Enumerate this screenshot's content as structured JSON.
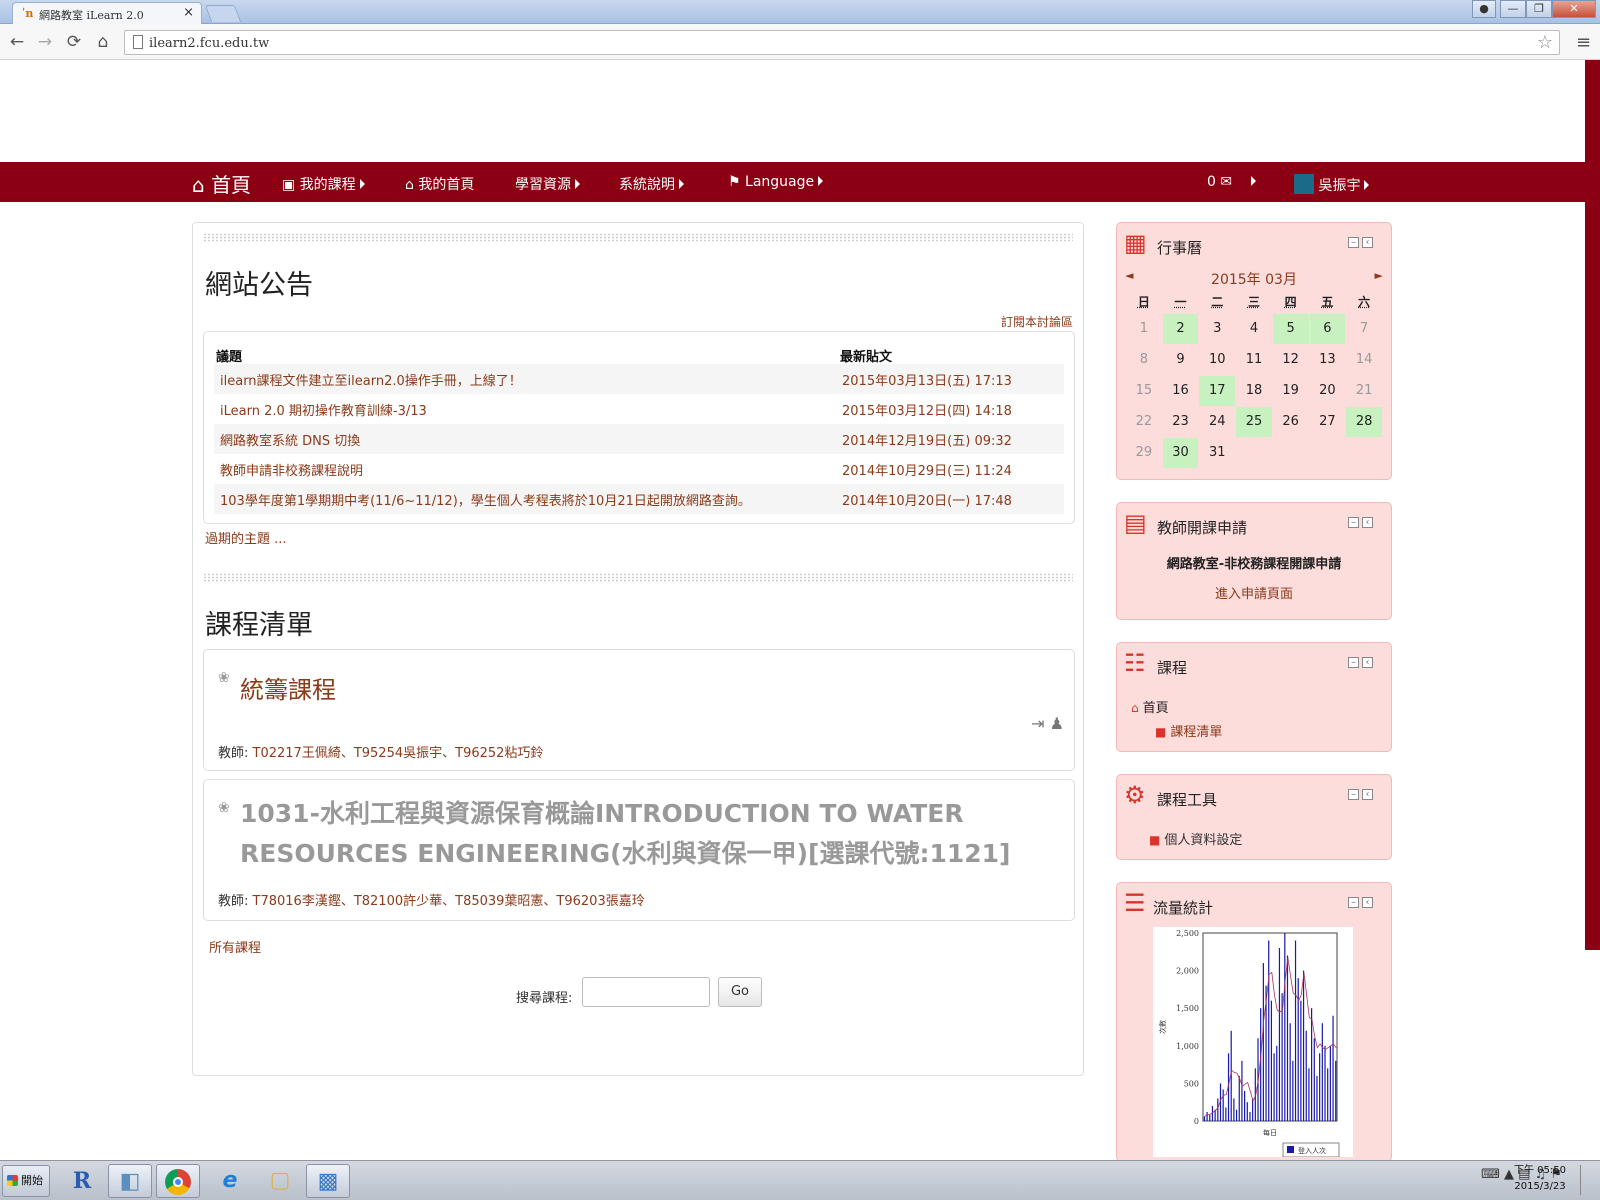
{
  "browser": {
    "tab_title": "網路教室 iLearn 2.0",
    "tab_close": "×",
    "url": "ilearn2.fcu.edu.tw",
    "back_icon": "←",
    "forward_icon": "→",
    "reload_icon": "⟳",
    "home_icon": "⌂",
    "star_icon": "☆",
    "menu_icon": "≡"
  },
  "navbar": {
    "home": "首頁",
    "my_courses": "我的課程",
    "my_home": "我的首頁",
    "resources": "學習資源",
    "system_help": "系統說明",
    "language": "Language",
    "messages": "0",
    "user_name": "吳振宇"
  },
  "announcements": {
    "title": "網站公告",
    "subscribe": "訂閱本討論區",
    "col_topic": "議題",
    "col_latest": "最新貼文",
    "rows": [
      {
        "topic": "ilearn課程文件建立至ilearn2.0操作手冊，上線了！",
        "date": "2015年03月13日(五) 17:13"
      },
      {
        "topic": "iLearn 2.0 期初操作教育訓練-3/13",
        "date": "2015年03月12日(四) 14:18"
      },
      {
        "topic": "網路教室系統 DNS 切換",
        "date": "2014年12月19日(五) 09:32"
      },
      {
        "topic": "教師申請非校務課程說明",
        "date": "2014年10月29日(三) 11:24"
      },
      {
        "topic": "103學年度第1學期期中考(11/6~11/12)，學生個人考程表將於10月21日起開放網路查詢。",
        "date": "2014年10月20日(一) 17:48"
      }
    ],
    "older": "過期的主題 ..."
  },
  "courses": {
    "title": "課程清單",
    "items": [
      {
        "name": "統籌課程",
        "teacher_label": "教師:",
        "teachers": "T02217王佩綺、T95254吳振宇、T96252粘巧鈴"
      },
      {
        "name": "1031-水利工程與資源保育概論INTRODUCTION TO WATER RESOURCES ENGINEERING(水利與資保一甲)[選課代號:1121]",
        "teacher_label": "教師:",
        "teachers": "T78016李漢鏗、T82100許少華、T85039葉昭憲、T96203張嘉玲"
      }
    ],
    "all_courses": "所有課程",
    "search_label": "搜尋課程:",
    "search_value": "",
    "go": "Go"
  },
  "calendar": {
    "title": "行事曆",
    "month": "2015年 03月",
    "prev": "◄",
    "next": "►",
    "weekdays": [
      "日",
      "一",
      "二",
      "三",
      "四",
      "五",
      "六"
    ],
    "weeks": [
      [
        "1",
        "2",
        "3",
        "4",
        "5",
        "6",
        "7"
      ],
      [
        "8",
        "9",
        "10",
        "11",
        "12",
        "13",
        "14"
      ],
      [
        "15",
        "16",
        "17",
        "18",
        "19",
        "20",
        "21"
      ],
      [
        "22",
        "23",
        "24",
        "25",
        "26",
        "27",
        "28"
      ],
      [
        "29",
        "30",
        "31",
        "",
        "",
        "",
        ""
      ]
    ],
    "event_days": [
      "2",
      "5",
      "6",
      "17",
      "25",
      "28",
      "30"
    ]
  },
  "teacher_apply": {
    "title": "教師開課申請",
    "heading": "網路教室-非校務課程開課申請",
    "link": "進入申請頁面"
  },
  "course_nav": {
    "title": "課程",
    "home": "首頁",
    "list": "課程清單"
  },
  "course_tools": {
    "title": "課程工具",
    "profile": "個人資料設定"
  },
  "traffic": {
    "title": "流量統計"
  },
  "chart_data": {
    "type": "bar",
    "ylabel": "次數",
    "xlabel": "每日",
    "yticks": [
      "0",
      "500",
      "1,000",
      "1,500",
      "2,000",
      "2,500"
    ],
    "ylim": [
      0,
      2500
    ],
    "legend": "登入人次",
    "values": [
      60,
      120,
      80,
      200,
      150,
      300,
      500,
      420,
      180,
      900,
      1200,
      300,
      150,
      600,
      800,
      400,
      250,
      120,
      300,
      700,
      1100,
      1500,
      2100,
      1800,
      2400,
      1600,
      900,
      1000,
      2300,
      1700,
      2500,
      2200,
      1300,
      800,
      2400,
      1900,
      1600,
      2000,
      1200,
      700,
      1500,
      1100,
      600,
      900,
      1300,
      1000,
      700,
      1000,
      1400,
      800
    ]
  },
  "taskbar": {
    "start": "開始",
    "time": "下午 05:50",
    "date": "2015/3/23"
  }
}
